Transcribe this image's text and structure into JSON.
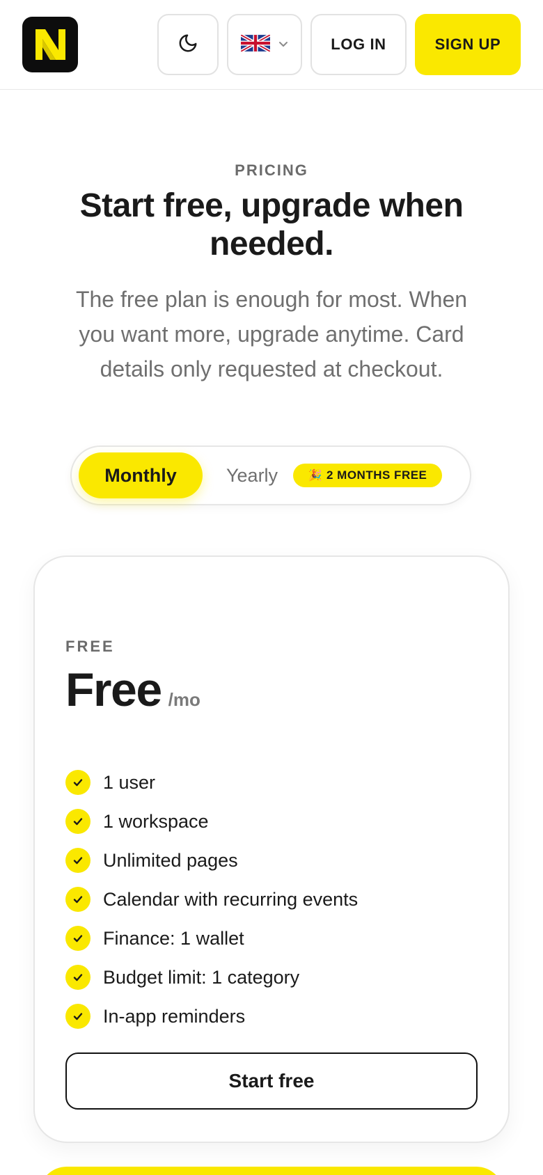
{
  "header": {
    "logo_icon": "n-logo-icon",
    "theme_icon": "moon-icon",
    "language_icon": "uk-flag-icon",
    "language_chevron_icon": "chevron-down-icon",
    "login_label": "LOG IN",
    "signup_label": "SIGN UP",
    "accent_color": "#fae800"
  },
  "hero": {
    "eyebrow": "PRICING",
    "title": "Start free, upgrade when needed.",
    "subtitle": "The free plan is enough for most. When you want more, upgrade anytime. Card details only requested at checkout."
  },
  "billing_toggle": {
    "options": [
      {
        "label": "Monthly",
        "selected": true
      },
      {
        "label": "Yearly",
        "selected": false
      }
    ],
    "promo_emoji": "🎉",
    "promo_text": "2 MONTHS FREE"
  },
  "plans": [
    {
      "tier": "FREE",
      "price": "Free",
      "period": "/mo",
      "features": [
        "1 user",
        "1 workspace",
        "Unlimited pages",
        "Calendar with recurring events",
        "Finance: 1 wallet",
        "Budget limit: 1 category",
        "In-app reminders"
      ],
      "cta_label": "Start free"
    }
  ]
}
